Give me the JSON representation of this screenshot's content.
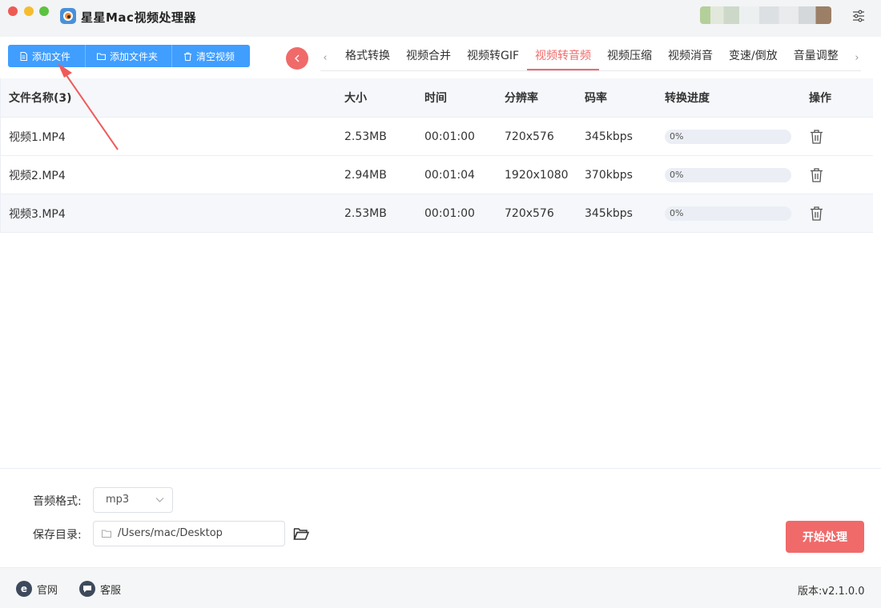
{
  "app": {
    "title": "星星Mac视频处理器"
  },
  "toolbar": {
    "add_file": "添加文件",
    "add_folder": "添加文件夹",
    "clear_videos": "清空视频"
  },
  "tabs": [
    {
      "label": "格式转换"
    },
    {
      "label": "视频合并"
    },
    {
      "label": "视频转GIF"
    },
    {
      "label": "视频转音频",
      "active": true
    },
    {
      "label": "视频压缩"
    },
    {
      "label": "视频消音"
    },
    {
      "label": "变速/倒放"
    },
    {
      "label": "音量调整"
    }
  ],
  "table": {
    "headers": {
      "name": "文件名称(3)",
      "size": "大小",
      "time": "时间",
      "resolution": "分辨率",
      "bitrate": "码率",
      "progress": "转换进度",
      "action": "操作"
    },
    "rows": [
      {
        "name": "视频1.MP4",
        "size": "2.53MB",
        "time": "00:01:00",
        "resolution": "720x576",
        "bitrate": "345kbps",
        "progress": "0%",
        "progress_value": 0
      },
      {
        "name": "视频2.MP4",
        "size": "2.94MB",
        "time": "00:01:04",
        "resolution": "1920x1080",
        "bitrate": "370kbps",
        "progress": "0%",
        "progress_value": 0
      },
      {
        "name": "视频3.MP4",
        "size": "2.53MB",
        "time": "00:01:00",
        "resolution": "720x576",
        "bitrate": "345kbps",
        "progress": "0%",
        "progress_value": 0
      }
    ]
  },
  "settings": {
    "format_label": "音频格式:",
    "format_value": "mp3",
    "dir_label": "保存目录:",
    "dir_value": "/Users/mac/Desktop",
    "start_button": "开始处理"
  },
  "footer": {
    "website": "官网",
    "support": "客服",
    "version": "版本:v2.1.0.0"
  },
  "colors": {
    "primary": "#409eff",
    "accent": "#f06a6a"
  }
}
